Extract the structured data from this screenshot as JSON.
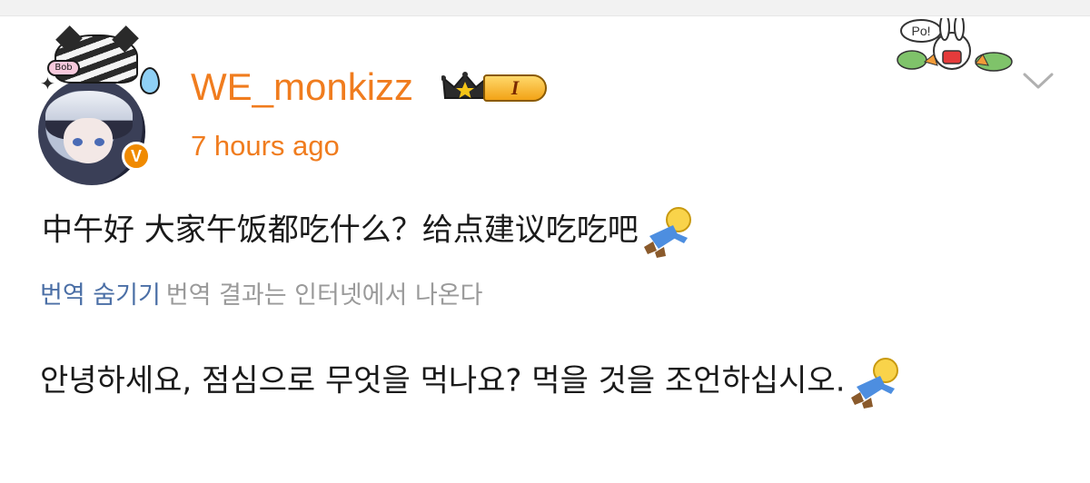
{
  "post": {
    "username": "WE_monkizz",
    "level_badge": "I",
    "timestamp": "7 hours ago",
    "content": "中午好 大家午饭都吃什么？给点建议吃吃吧",
    "translate": {
      "hide_label": "번역 숨기기",
      "source_note": "번역 결과는 인터넷에서 나온다",
      "translated_text": "안녕하세요, 점심으로 무엇을 먹나요? 먹을 것을 조언하십시오."
    }
  },
  "avatar": {
    "bow_text": "Bob",
    "verified_mark": "V"
  },
  "sticker": {
    "bubble_text": "Po!"
  },
  "icons": {
    "crown": "crown-icon",
    "chevron": "chevron-down-icon",
    "emoji": "lying-doll-emoji-icon",
    "verified": "verified-badge-icon"
  },
  "colors": {
    "username": "#f07c1e",
    "timestamp": "#f07c1e",
    "link": "#4b6fa6",
    "muted": "#9a9a9a",
    "verified_badge": "#f08a00"
  }
}
